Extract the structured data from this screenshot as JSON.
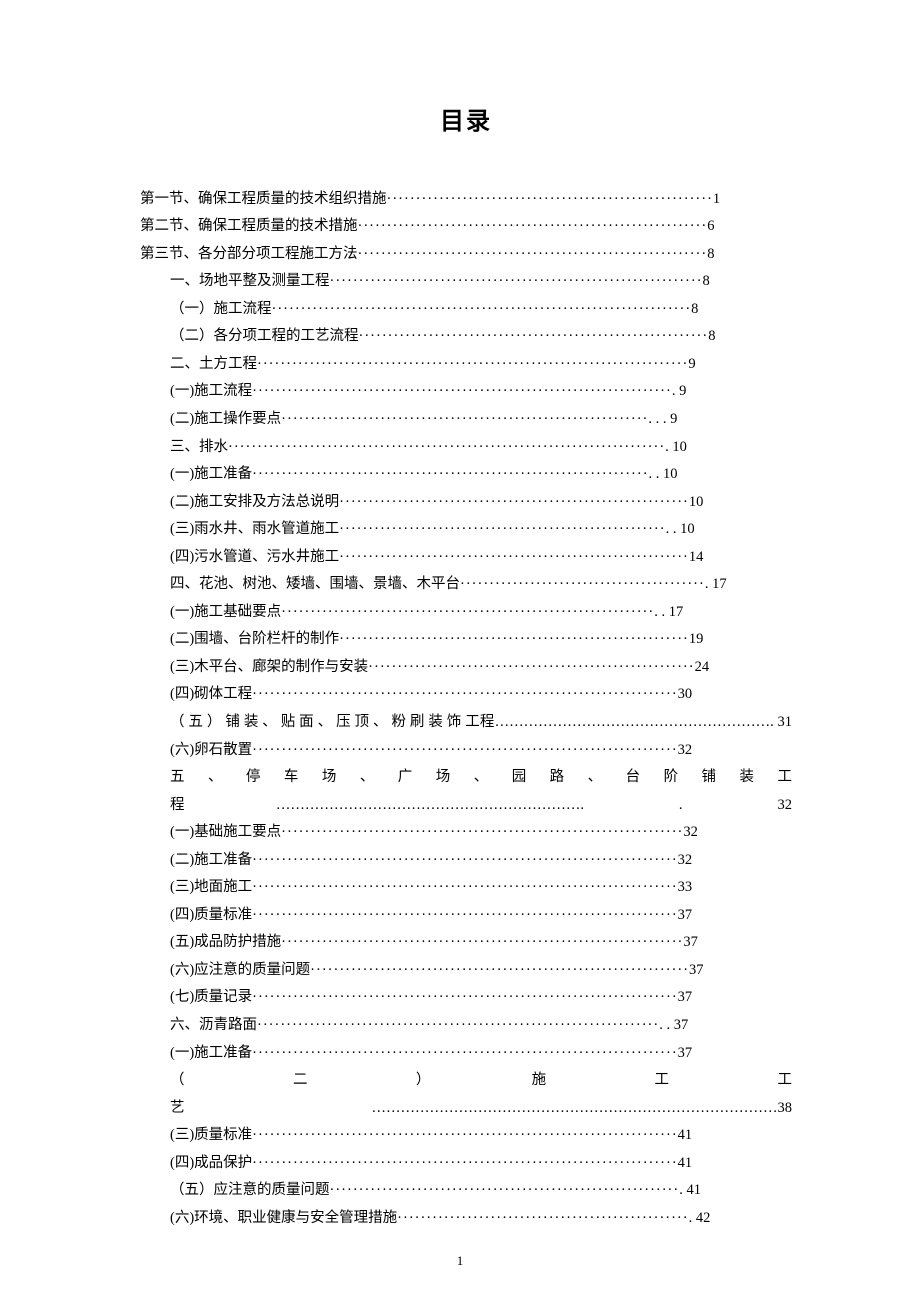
{
  "title": "目录",
  "page_number": "1",
  "entries": [
    {
      "indent": 0,
      "label": "第一节、确保工程质量的技术组织措施",
      "page": "1",
      "class": ""
    },
    {
      "indent": 0,
      "label": "第二节、确保工程质量的技术措施",
      "page": "6",
      "class": ""
    },
    {
      "indent": 0,
      "label": "第三节、各分部分项工程施工方法",
      "page": "8",
      "class": ""
    },
    {
      "indent": 1,
      "label": "一、场地平整及测量工程",
      "page": "8",
      "class": "indent-1"
    },
    {
      "indent": 2,
      "label": "（一）施工流程",
      "page": "8",
      "class": "indent-2"
    },
    {
      "indent": 2,
      "label": "（二）各分项工程的工艺流程",
      "page": "8",
      "class": "indent-2"
    },
    {
      "indent": 1,
      "label": "二、土方工程",
      "page": "9",
      "class": "indent-1"
    },
    {
      "indent": 2,
      "label": "(一)施工流程",
      "page": ". 9",
      "class": "indent-2"
    },
    {
      "indent": 2,
      "label": "(二)施工操作要点",
      "page": ". . . 9",
      "class": "indent-2"
    },
    {
      "indent": 1,
      "label": "三、排水",
      "page": ". 10",
      "class": "indent-1"
    },
    {
      "indent": 2,
      "label": "(一)施工准备",
      "page": ". . 10",
      "class": "indent-2"
    },
    {
      "indent": 2,
      "label": "(二)施工安排及方法总说明",
      "page": "10",
      "class": "indent-2"
    },
    {
      "indent": 2,
      "label": "(三)雨水井、雨水管道施工",
      "page": ". . 10",
      "class": "indent-2"
    },
    {
      "indent": 2,
      "label": "(四)污水管道、污水井施工",
      "page": "14",
      "class": "indent-2"
    },
    {
      "indent": 1,
      "label": "四、花池、树池、矮墙、围墙、景墙、木平台",
      "page": ". 17",
      "class": "indent-1"
    },
    {
      "indent": 2,
      "label": "(一)施工基础要点",
      "page": ". . 17",
      "class": "indent-2"
    },
    {
      "indent": 2,
      "label": "(二)围墙、台阶栏杆的制作",
      "page": "19",
      "class": "indent-2"
    },
    {
      "indent": 2,
      "label": "(三)木平台、廊架的制作与安装",
      "page": "24",
      "class": "indent-2"
    },
    {
      "indent": 2,
      "label": "(四)砌体工程",
      "page": "30",
      "class": "indent-2"
    },
    {
      "indent": 2,
      "label": "（ 五 ） 铺 装 、 贴 面 、 压 顶 、 粉 刷 装 饰 工程…………………………………………………. 31",
      "page": "",
      "class": "wrap",
      "raw": true,
      "justify": true
    },
    {
      "indent": 2,
      "label": "(六)卵石散置",
      "page": "32",
      "class": "indent-2"
    },
    {
      "indent": 1,
      "label": "五 、 停 车 场 、 广 场 、 园 路 、 台 阶 铺 装 工程………………………………………………………. . 32",
      "page": "",
      "class": "wrap",
      "raw": true,
      "justify": true
    },
    {
      "indent": 2,
      "label": "(一)基础施工要点",
      "page": "32",
      "class": "indent-2"
    },
    {
      "indent": 2,
      "label": "(二)施工准备",
      "page": "32",
      "class": "indent-2"
    },
    {
      "indent": 2,
      "label": "(三)地面施工",
      "page": "33",
      "class": "indent-2"
    },
    {
      "indent": 2,
      "label": "(四)质量标准",
      "page": "37",
      "class": "indent-2"
    },
    {
      "indent": 2,
      "label": "(五)成品防护措施",
      "page": "37",
      "class": "indent-2"
    },
    {
      "indent": 2,
      "label": "(六)应注意的质量问题",
      "page": "37",
      "class": "indent-2"
    },
    {
      "indent": 2,
      "label": "(七)质量记录",
      "page": "37",
      "class": "indent-2"
    },
    {
      "indent": 1,
      "label": "六、沥青路面",
      "page": ". . 37",
      "class": "indent-1"
    },
    {
      "indent": 2,
      "label": "(一)施工准备",
      "page": "37",
      "class": "indent-2"
    },
    {
      "indent": 2,
      "label": "（　　　二　　　）　　　施　　　工　　　工艺…………………………………………………………………………38",
      "page": "",
      "class": "wrap",
      "raw": true,
      "justify": true
    },
    {
      "indent": 2,
      "label": "(三)质量标准",
      "page": "41",
      "class": "indent-2"
    },
    {
      "indent": 2,
      "label": "(四)成品保护",
      "page": "41",
      "class": "indent-2"
    },
    {
      "indent": 2,
      "label": "（五）应注意的质量问题",
      "page": ". 41",
      "class": "indent-2"
    },
    {
      "indent": 2,
      "label": "(六)环境、职业健康与安全管理措施",
      "page": ". 42",
      "class": "indent-2"
    }
  ]
}
